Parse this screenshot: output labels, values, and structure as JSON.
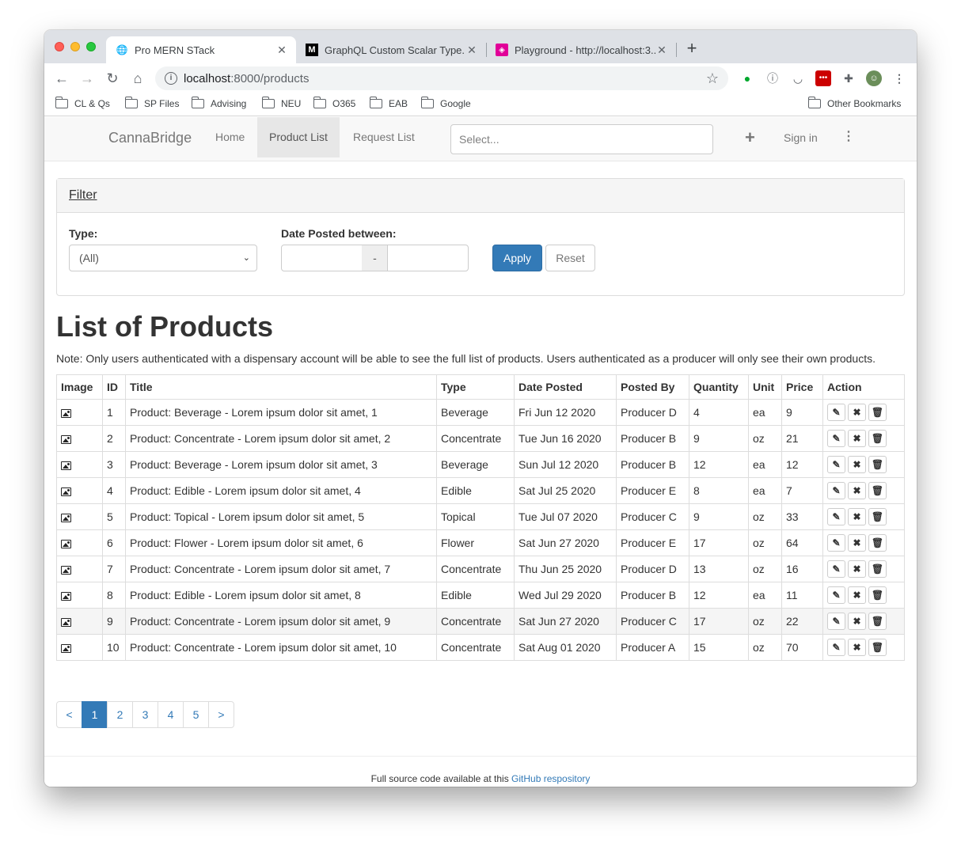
{
  "browser": {
    "tabs": [
      {
        "title": "Pro MERN STack",
        "favicon": "globe-icon"
      },
      {
        "title": "GraphQL Custom Scalar Type...",
        "favicon": "medium-icon"
      },
      {
        "title": "Playground - http://localhost:3...",
        "favicon": "graphql-icon"
      }
    ],
    "url_host": "localhost",
    "url_path": ":8000/products",
    "bookmarks": [
      "CL & Qs",
      "SP Files",
      "Advising",
      "NEU",
      "O365",
      "EAB",
      "Google"
    ],
    "other_bookmarks": "Other Bookmarks"
  },
  "navbar": {
    "brand": "CannaBridge",
    "links": [
      "Home",
      "Product List",
      "Request List"
    ],
    "active": "Product List",
    "search_placeholder": "Select...",
    "signin": "Sign in"
  },
  "filter": {
    "title": "Filter",
    "type_label": "Type:",
    "type_value": "(All)",
    "date_label": "Date Posted between:",
    "date_sep": "-",
    "apply": "Apply",
    "reset": "Reset"
  },
  "main": {
    "heading": "List of Products",
    "note": "Note: Only users authenticated with a dispensary account will be able to see the full list of products. Users authenticated as a producer will only see their own products."
  },
  "table": {
    "columns": [
      "Image",
      "ID",
      "Title",
      "Type",
      "Date Posted",
      "Posted By",
      "Quantity",
      "Unit",
      "Price",
      "Action"
    ],
    "rows": [
      {
        "id": "1",
        "title": "Product: Beverage - Lorem ipsum dolor sit amet, 1",
        "type": "Beverage",
        "date": "Fri Jun 12 2020",
        "by": "Producer D",
        "qty": "4",
        "unit": "ea",
        "price": "9"
      },
      {
        "id": "2",
        "title": "Product: Concentrate - Lorem ipsum dolor sit amet, 2",
        "type": "Concentrate",
        "date": "Tue Jun 16 2020",
        "by": "Producer B",
        "qty": "9",
        "unit": "oz",
        "price": "21"
      },
      {
        "id": "3",
        "title": "Product: Beverage - Lorem ipsum dolor sit amet, 3",
        "type": "Beverage",
        "date": "Sun Jul 12 2020",
        "by": "Producer B",
        "qty": "12",
        "unit": "ea",
        "price": "12"
      },
      {
        "id": "4",
        "title": "Product: Edible - Lorem ipsum dolor sit amet, 4",
        "type": "Edible",
        "date": "Sat Jul 25 2020",
        "by": "Producer E",
        "qty": "8",
        "unit": "ea",
        "price": "7"
      },
      {
        "id": "5",
        "title": "Product: Topical - Lorem ipsum dolor sit amet, 5",
        "type": "Topical",
        "date": "Tue Jul 07 2020",
        "by": "Producer C",
        "qty": "9",
        "unit": "oz",
        "price": "33"
      },
      {
        "id": "6",
        "title": "Product: Flower - Lorem ipsum dolor sit amet, 6",
        "type": "Flower",
        "date": "Sat Jun 27 2020",
        "by": "Producer E",
        "qty": "17",
        "unit": "oz",
        "price": "64"
      },
      {
        "id": "7",
        "title": "Product: Concentrate - Lorem ipsum dolor sit amet, 7",
        "type": "Concentrate",
        "date": "Thu Jun 25 2020",
        "by": "Producer D",
        "qty": "13",
        "unit": "oz",
        "price": "16"
      },
      {
        "id": "8",
        "title": "Product: Edible - Lorem ipsum dolor sit amet, 8",
        "type": "Edible",
        "date": "Wed Jul 29 2020",
        "by": "Producer B",
        "qty": "12",
        "unit": "ea",
        "price": "11"
      },
      {
        "id": "9",
        "title": "Product: Concentrate - Lorem ipsum dolor sit amet, 9",
        "type": "Concentrate",
        "date": "Sat Jun 27 2020",
        "by": "Producer C",
        "qty": "17",
        "unit": "oz",
        "price": "22"
      },
      {
        "id": "10",
        "title": "Product: Concentrate - Lorem ipsum dolor sit amet, 10",
        "type": "Concentrate",
        "date": "Sat Aug 01 2020",
        "by": "Producer A",
        "qty": "15",
        "unit": "oz",
        "price": "70"
      }
    ],
    "hover_row": "9"
  },
  "pagination": {
    "prev": "<",
    "pages": [
      "1",
      "2",
      "3",
      "4",
      "5"
    ],
    "active": "1",
    "next": ">"
  },
  "footer": {
    "text": "Full source code available at this ",
    "link": "GitHub respository"
  },
  "colors": {
    "primary": "#337ab7",
    "navbar_bg": "#f8f8f8",
    "tabstrip_bg": "#dee1e6"
  }
}
